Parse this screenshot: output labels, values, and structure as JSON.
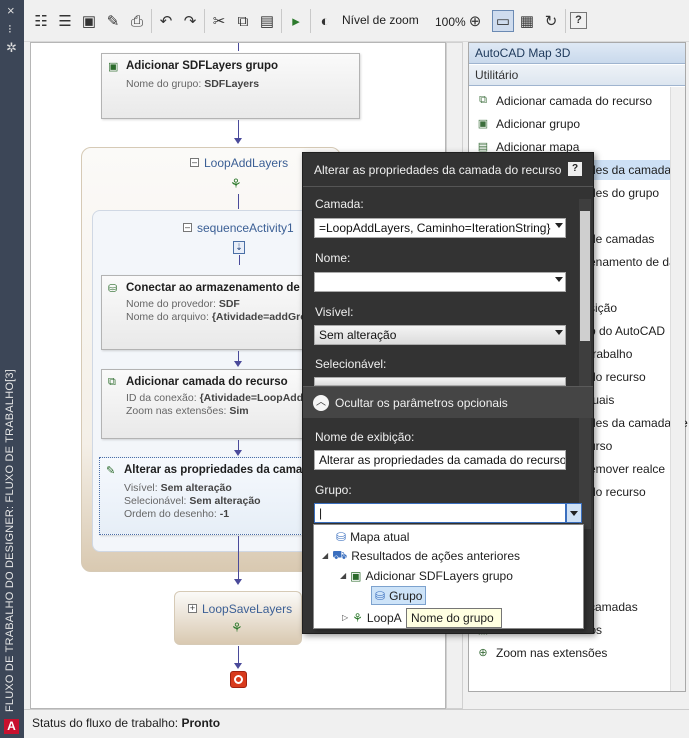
{
  "window": {
    "vertical_title": "FLUXO DE TRABALHO DO DESIGNER: FLUXO DE TRABALHO[3]",
    "close_glyph": "×",
    "pin_glyph": "⁝",
    "gear_glyph": "✲",
    "autocad_logo": "A"
  },
  "toolbar": {
    "zoom_label": "Nível de zoom",
    "zoom_value": "100%",
    "icons": [
      "new-icon",
      "properties-icon",
      "save-icon",
      "save-as-icon",
      "print-icon",
      "undo-icon",
      "redo-icon",
      "cut-icon",
      "copy-icon",
      "paste-icon",
      "run-icon",
      "zoom-level-icon",
      "zoom-icon",
      "view-mode-icon",
      "panel-icon",
      "refresh-icon",
      "help-icon"
    ]
  },
  "workflow": {
    "top_activity": {
      "title": "Adicionar SDFLayers grupo",
      "rows": [
        {
          "key": "Nome do grupo:",
          "value": "SDFLayers"
        }
      ]
    },
    "loop": {
      "label": "LoopAddLayers"
    },
    "sequence": {
      "label": "sequenceActivity1"
    },
    "activity_connect": {
      "title": "Conectar ao armazenamento de da",
      "rows": [
        {
          "key": "Nome do provedor:",
          "value": "SDF"
        },
        {
          "key": "Nome do arquivo:",
          "value": "{Atividade=addGrou"
        }
      ]
    },
    "activity_addlayer": {
      "title": "Adicionar camada do recurso",
      "rows": [
        {
          "key": "ID da conexão:",
          "value": "{Atividade=LoopAddLay"
        },
        {
          "key": "Zoom nas extensões:",
          "value": "Sim"
        }
      ]
    },
    "activity_alter": {
      "title": "Alterar as propriedades da camada",
      "rows": [
        {
          "key": "Visível:",
          "value": "Sem alteração"
        },
        {
          "key": "Selecionável:",
          "value": "Sem alteração"
        },
        {
          "key": "Ordem do desenho:",
          "value": "-1"
        }
      ]
    },
    "save_loop": {
      "label": "LoopSaveLayers"
    }
  },
  "right_panel": {
    "header1": "AutoCAD Map 3D",
    "header2": "Utilitário",
    "items": [
      {
        "label": "Adicionar camada do recurso",
        "icon": "add-layer-icon"
      },
      {
        "label": "Adicionar grupo",
        "icon": "add-group-icon"
      },
      {
        "label": "Adicionar mapa",
        "icon": "add-map-icon"
      },
      {
        "label": "des da camada d",
        "icon": "layer-props-icon"
      },
      {
        "label": "des do grupo",
        "icon": "group-props-icon"
      },
      {
        "label": "de camadas",
        "icon": "layers-icon"
      },
      {
        "label": "enamento de dad",
        "icon": "data-store-icon"
      },
      {
        "label": "sição",
        "icon": "position-icon"
      },
      {
        "label": "o do AutoCAD",
        "icon": "autocad-icon"
      },
      {
        "label": "trabalho",
        "icon": "workflow-icon"
      },
      {
        "label": "do recurso",
        "icon": "resource-icon"
      },
      {
        "label": "tuais",
        "icon": "current-icon"
      },
      {
        "label": "des da camada de",
        "icon": "layer-props2-icon"
      },
      {
        "label": "urso",
        "icon": "resource2-icon"
      },
      {
        "label": "emover realce",
        "icon": "remove-highlight-icon"
      },
      {
        "label": "do recurso",
        "icon": "resource3-icon"
      },
      {
        "label": "camadas",
        "icon": "layers2-icon"
      },
      {
        "label": "Selecionar recursos",
        "icon": "select-features-icon"
      },
      {
        "label": "Zoom nas extensões",
        "icon": "zoom-extents-icon"
      }
    ]
  },
  "dialog": {
    "title": "Alterar as propriedades da camada do recurso",
    "help": "?",
    "layer_label": "Camada:",
    "layer_value": "=LoopAddLayers, Caminho=IterationString}",
    "name_label": "Nome:",
    "name_value": "",
    "visible_label": "Visível:",
    "visible_value": "Sem alteração",
    "selectable_label": "Selecionável:",
    "selectable_value": "Sem alteração",
    "optional_toggle": "Ocultar os parâmetros opcionais",
    "display_name_label": "Nome de exibição:",
    "display_name_value": "Alterar as propriedades da camada do recurso",
    "group_label": "Grupo:",
    "group_value": ""
  },
  "group_popup": {
    "items": [
      {
        "label": "Mapa atual",
        "expander": ""
      },
      {
        "label": "Resultados de ações anteriores",
        "expander": "◢"
      },
      {
        "label": "Adicionar SDFLayers grupo",
        "expander": "◢"
      },
      {
        "label": "Grupo",
        "expander": ""
      },
      {
        "label": "LoopA",
        "expander": "▷"
      }
    ],
    "tooltip": "Nome do grupo"
  },
  "status": {
    "label": "Status do fluxo de trabalho:",
    "value": "Pronto"
  },
  "colors": {
    "accent": "#3c4657",
    "dialog_bg": "#333333",
    "link": "#3b5f95"
  }
}
